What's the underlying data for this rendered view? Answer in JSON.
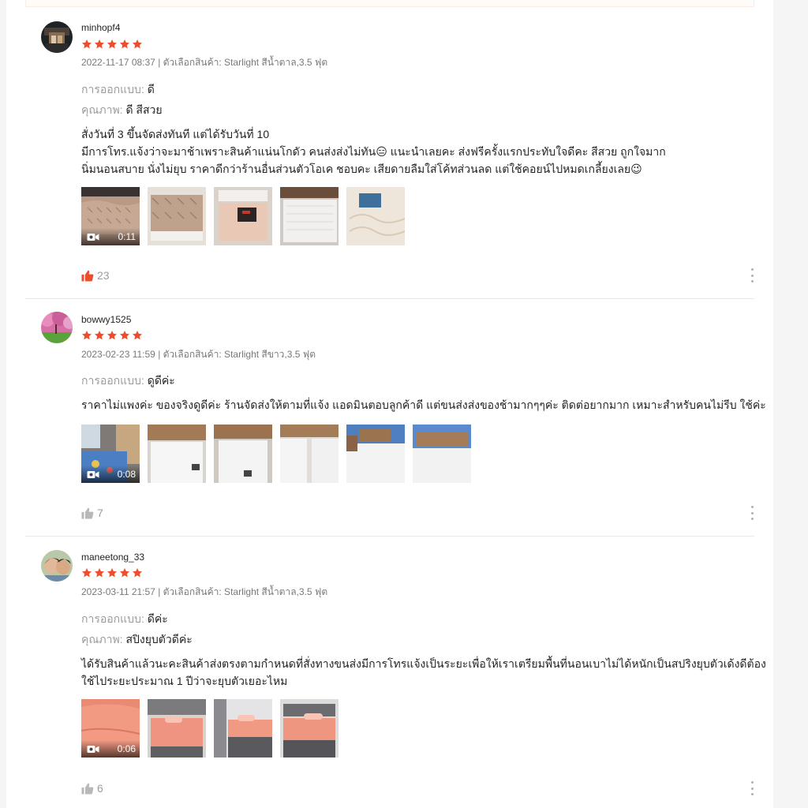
{
  "reviews": [
    {
      "username": "minhopf4",
      "rating": 5,
      "meta": "2022-11-17 08:37 | ตัวเลือกสินค้า: Starlight สีน้ำตาล,3.5 ฟุต",
      "attributes": [
        {
          "label": "การออกแบบ:",
          "value": "ดี"
        },
        {
          "label": "คุณภาพ:",
          "value": "ดี สีสวย"
        }
      ],
      "text_lines": [
        "สั่งวันที่ 3 ขึ้นจัดส่งทันที แต่ได้รับวันที่ 10",
        "มีการโทร.แจ้งว่าจะมาช้าเพราะสินค้าแน่นโกดัว คนส่งส่งไม่ทัน😑 แนะนำเลยคะ ส่งฟรีครั้งแรกประทับใจดีคะ สีสวย ถูกใจมาก",
        "นิ่มนอนสบาย นั่งไม่ยุบ ราคาดีกว่าร้านอื่นส่วนตัวโอเค ชอบคะ เสียดายลืมใส่โค้ทส่วนลด แต่ใช้คอยน์ไปหมดเกลี้ยงเลย😉"
      ],
      "video_duration": "0:11",
      "likes": "23",
      "liked": true
    },
    {
      "username": "bowwy1525",
      "rating": 5,
      "meta": "2023-02-23 11:59 | ตัวเลือกสินค้า: Starlight สีขาว,3.5 ฟุต",
      "attributes": [
        {
          "label": "การออกแบบ:",
          "value": "ดูดีค่ะ"
        }
      ],
      "text_lines": [
        "ราคาไม่แพงค่ะ ของจริงดูดีค่ะ ร้านจัดส่งให้ตามที่แจ้ง แอดมินตอบลูกค้าดี แต่ขนส่งส่งของช้ามากๆๆค่ะ ติดต่อยากมาก เหมาะสำหรับคนไม่รีบ ใช้ค่ะ"
      ],
      "video_duration": "0:08",
      "likes": "7",
      "liked": false
    },
    {
      "username": "maneetong_33",
      "rating": 5,
      "meta": "2023-03-11 21:57 | ตัวเลือกสินค้า: Starlight สีน้ำตาล,3.5 ฟุต",
      "attributes": [
        {
          "label": "การออกแบบ:",
          "value": "ดีค่ะ"
        },
        {
          "label": "คุณภาพ:",
          "value": "สปิงยุบตัวดีค่ะ"
        }
      ],
      "text_lines": [
        "ได้รับสินค้าแล้วนะคะสินค้าส่งตรงตามกำหนดที่สั่งทางขนส่งมีการโทรแจ้งเป็นระยะเพื่อให้เราเตรียมพื้นที่นอนเบาไม่ได้หนักเป็นสปริงยุบตัวเด้งดีต้อง",
        "ใช้ไประยะประมาณ 1 ปีว่าจะยุบตัวเยอะไหม"
      ],
      "video_duration": "0:06",
      "likes": "6",
      "liked": false
    }
  ],
  "colors": {
    "star": "#ee4d2d",
    "like_active": "#ee4d2d",
    "like_inactive": "#b8b8b8"
  }
}
